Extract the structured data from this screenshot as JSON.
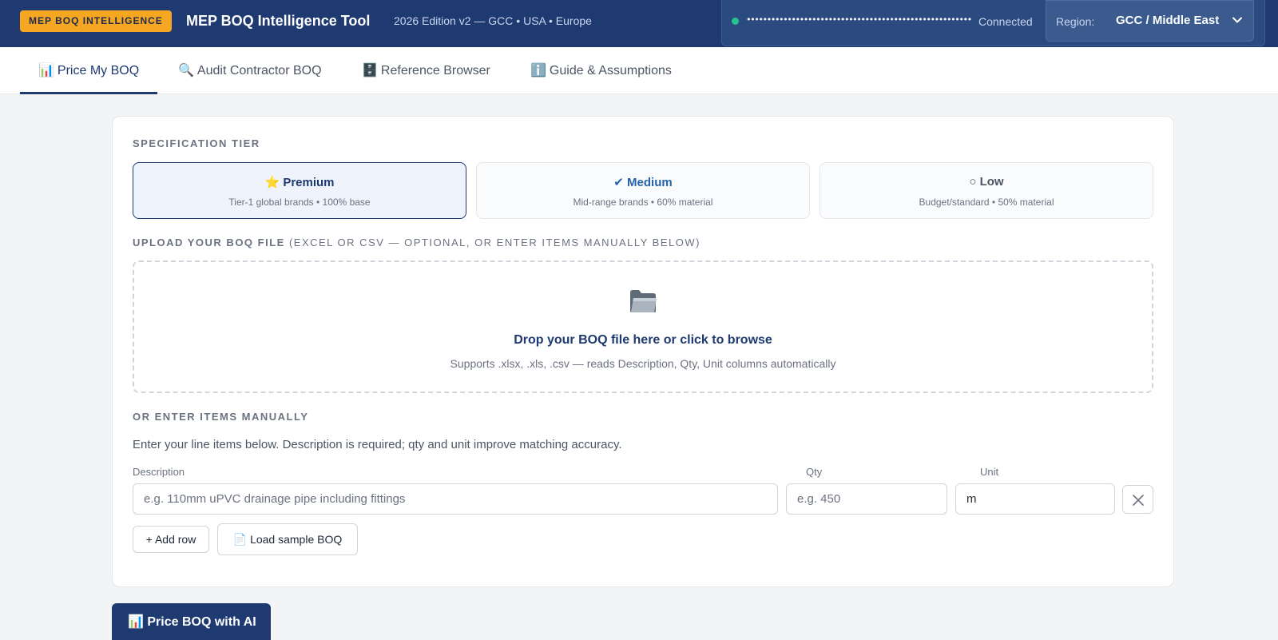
{
  "header": {
    "badge": "MEP BOQ INTELLIGENCE",
    "title": "MEP BOQ Intelligence Tool",
    "edition": "2026 Edition v2 — GCC • USA • Europe",
    "api_key_masked": "••••••••••••••••••••••••••••••••••••••••••••••••••••••••••",
    "connection_status": "Connected",
    "status_color": "#22c38e",
    "region_label": "Region:",
    "region_value": "GCC / Middle East"
  },
  "tabs": [
    {
      "icon": "📊",
      "label": "Price My BOQ",
      "active": true
    },
    {
      "icon": "🔍",
      "label": "Audit Contractor BOQ",
      "active": false
    },
    {
      "icon": "🗄️",
      "label": "Reference Browser",
      "active": false
    },
    {
      "icon": "ℹ️",
      "label": "Guide & Assumptions",
      "active": false
    }
  ],
  "spec_tier": {
    "label": "SPECIFICATION TIER",
    "options": [
      {
        "icon": "⭐",
        "name": "Premium",
        "desc": "Tier-1 global brands • 100% base",
        "selected": true,
        "color": "#1e3a70"
      },
      {
        "icon": "✔",
        "name": "Medium",
        "desc": "Mid-range brands • 60% material",
        "selected": false,
        "color": "#2563a8"
      },
      {
        "icon": "○",
        "name": "Low",
        "desc": "Budget/standard • 50% material",
        "selected": false,
        "color": "#4b5563"
      }
    ]
  },
  "upload": {
    "label": "UPLOAD YOUR BOQ FILE",
    "label_suffix": "(EXCEL OR CSV — OPTIONAL, OR ENTER ITEMS MANUALLY BELOW)",
    "icon": "folder-icon",
    "title": "Drop your BOQ file here or click to browse",
    "subtitle": "Supports .xlsx, .xls, .csv — reads Description, Qty, Unit columns automatically"
  },
  "manual": {
    "label": "OR ENTER ITEMS MANUALLY",
    "helper": "Enter your line items below. Description is required; qty and unit improve matching accuracy.",
    "columns": {
      "description": "Description",
      "qty": "Qty",
      "unit": "Unit"
    },
    "row": {
      "description_placeholder": "e.g. 110mm uPVC drainage pipe including fittings",
      "description_value": "",
      "qty_placeholder": "e.g. 450",
      "qty_value": "",
      "unit_value": "m"
    },
    "add_row_label": "+ Add row",
    "sample_icon": "📄",
    "sample_label": "Load sample BOQ"
  },
  "action": {
    "icon": "📊",
    "label": "Price BOQ with AI"
  }
}
